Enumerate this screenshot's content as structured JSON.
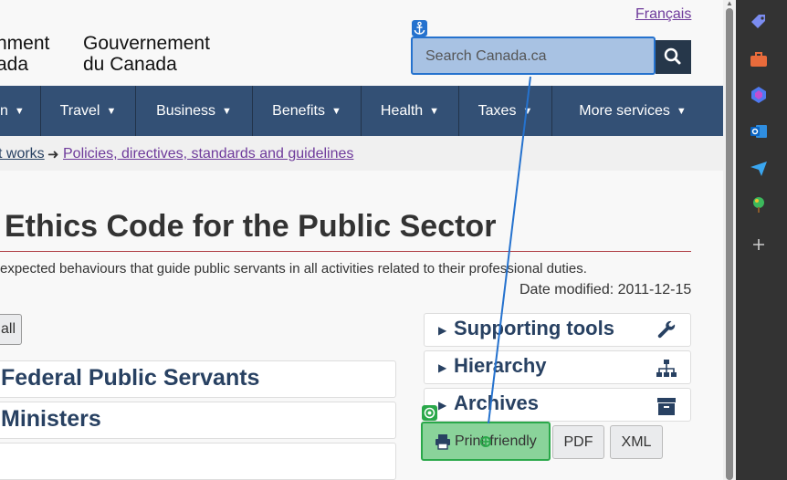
{
  "header": {
    "language_link": "Français",
    "wordmark_en_line1": "nment",
    "wordmark_en_line2": "ada",
    "wordmark_fr_line1": "Gouvernement",
    "wordmark_fr_line2": "du Canada",
    "search_placeholder": "Search Canada.ca"
  },
  "nav": {
    "items": [
      {
        "label": "n"
      },
      {
        "label": "Travel"
      },
      {
        "label": "Business"
      },
      {
        "label": "Benefits"
      },
      {
        "label": "Health"
      },
      {
        "label": "Taxes"
      },
      {
        "label": "More services"
      }
    ]
  },
  "breadcrumb": {
    "item1": "t works",
    "separator": "➜",
    "item2": "Policies, directives, standards and guidelines"
  },
  "main": {
    "title": "Ethics Code for the Public Sector",
    "lead": "expected behaviours that guide public servants in all activities related to their professional duties.",
    "date_modified": "Date modified: 2011-12-15",
    "expand_button": "all",
    "left_panels": [
      "Federal Public Servants",
      "Ministers",
      ""
    ],
    "right_panels": [
      {
        "label": "Supporting tools",
        "icon": "wrench-icon"
      },
      {
        "label": "Hierarchy",
        "icon": "sitemap-icon"
      },
      {
        "label": "Archives",
        "icon": "archive-icon"
      }
    ],
    "buttons": {
      "print": "Print-friendly",
      "pdf": "PDF",
      "xml": "XML"
    }
  },
  "colors": {
    "nav_bg": "#335075",
    "link": "#284162",
    "visited": "#6e3a9b",
    "title_rule": "#af3c43",
    "anchor_overlay": "#2572ce",
    "target_overlay": "#2aa84a",
    "sidebar_bg": "#333333"
  },
  "browser_sidebar": {
    "icons": [
      "tag-icon",
      "briefcase-icon",
      "copilot-icon",
      "outlook-icon",
      "send-icon",
      "tree-icon",
      "add-icon"
    ]
  }
}
